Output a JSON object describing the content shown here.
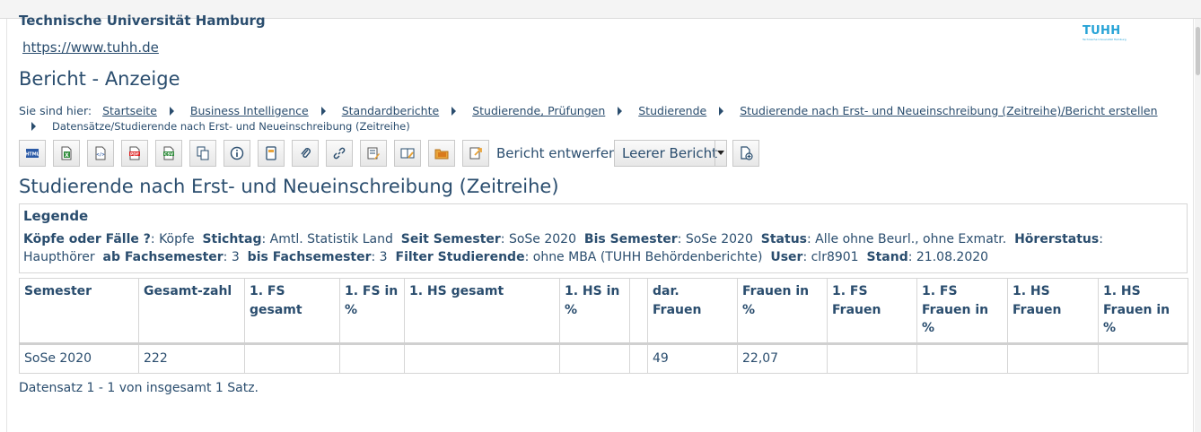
{
  "header": {
    "university": "Technische Universität Hamburg",
    "url": "https://www.tuhh.de",
    "logo_text": "TUHH",
    "logo_subtext": "Technische Universität Hamburg"
  },
  "page_title": "Bericht - Anzeige",
  "breadcrumb": {
    "prefix": "Sie sind hier:",
    "items": [
      "Startseite",
      "Business Intelligence",
      "Standardberichte",
      "Studierende, Prüfungen",
      "Studierende",
      "Studierende nach Erst- und Neueinschreibung (Zeitreihe)/Bericht erstellen",
      "Datensätze/Studierende nach Erst- und Neueinschreibung (Zeitreihe)"
    ]
  },
  "toolbar": {
    "buttons": [
      "html-export",
      "excel-export",
      "xml-export",
      "pdf-export",
      "csv-export",
      "copy",
      "info",
      "note",
      "attach",
      "link",
      "edit-report",
      "compare-report",
      "folder",
      "export-report"
    ],
    "design_label": "Bericht entwerfen:",
    "design_select_value": "Leerer Bericht",
    "new_report_button": "new-report"
  },
  "report_title": "Studierende nach Erst- und Neueinschreibung (Zeitreihe)",
  "legend": {
    "heading": "Legende",
    "items": [
      {
        "key": "Köpfe oder Fälle ?",
        "value": "Köpfe"
      },
      {
        "key": "Stichtag",
        "value": "Amtl. Statistik Land"
      },
      {
        "key": "Seit Semester",
        "value": "SoSe 2020"
      },
      {
        "key": "Bis Semester",
        "value": "SoSe 2020"
      },
      {
        "key": "Status",
        "value": "Alle ohne Beurl., ohne Exmatr."
      },
      {
        "key": "Hörerstatus",
        "value": "Haupthörer"
      },
      {
        "key": "ab Fachsemester",
        "value": "3"
      },
      {
        "key": "bis Fachsemester",
        "value": "3"
      },
      {
        "key": "Filter Studierende",
        "value": "ohne MBA (TUHH Behördenberichte)"
      },
      {
        "key": "User",
        "value": "clr8901"
      },
      {
        "key": "Stand",
        "value": "21.08.2020"
      }
    ]
  },
  "table": {
    "columns": [
      "Semester",
      "Gesamt-zahl",
      "1. FS gesamt",
      "1. FS in %",
      "1. HS gesamt",
      "1. HS in %",
      "",
      "dar. Frauen",
      "Frauen in %",
      "1. FS Frauen",
      "1. FS Frauen in %",
      "1. HS Frauen",
      "1. HS Frauen in %"
    ],
    "rows": [
      [
        "SoSe 2020",
        "222",
        "",
        "",
        "",
        "",
        "",
        "49",
        "22,07",
        "",
        "",
        "",
        ""
      ]
    ]
  },
  "record_info": "Datensatz 1 - 1 von insgesamt 1 Satz."
}
